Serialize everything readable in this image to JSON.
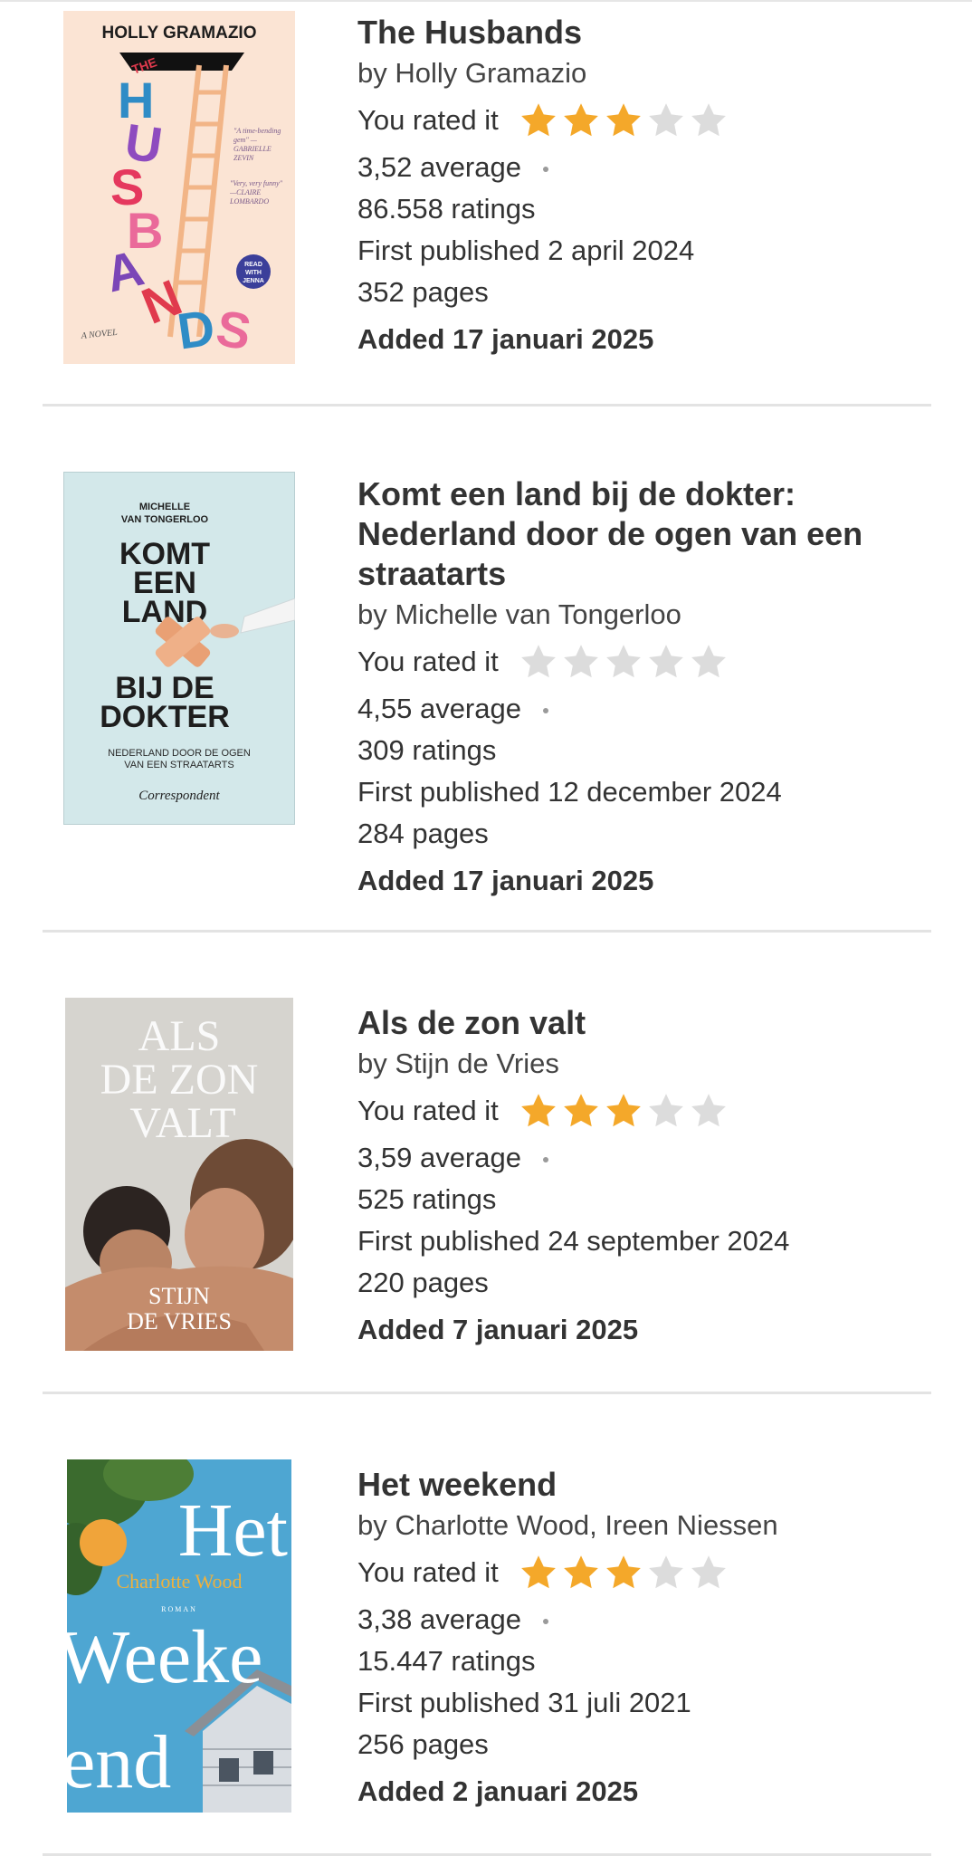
{
  "colors": {
    "star_filled": "#F4A82A",
    "star_empty": "#DCDCDC",
    "divider": "#E3E3E3",
    "text": "#333333"
  },
  "books": [
    {
      "title": "The Husbands",
      "author": "by Holly Gramazio",
      "rated_label": "You rated it",
      "user_rating": 3,
      "average": "3,52 average",
      "ratings": "86.558 ratings",
      "first_published": "First published 2 april 2024",
      "pages": "352 pages",
      "added": "Added 17 januari 2025",
      "cover": {
        "author_text": "HOLLY GRAMAZIO",
        "title_letters": [
          "H",
          "U",
          "S",
          "B",
          "A",
          "N",
          "D",
          "S"
        ],
        "the": "THE",
        "quote1": "\"A time-bending gem\" —GABRIELLE ZEVIN",
        "quote2": "\"Very, very funny\" —CLAIRE LOMBARDO",
        "badge": "READ WITH JENNA",
        "novel": "A NOVEL"
      }
    },
    {
      "title": "Komt een land bij de dokter: Nederland door de ogen van een straatarts",
      "author": "by Michelle van Tongerloo",
      "rated_label": "You rated it",
      "user_rating": 0,
      "average": "4,55 average",
      "ratings": "309 ratings",
      "first_published": "First published 12 december 2024",
      "pages": "284 pages",
      "added": "Added 17 januari 2025",
      "cover": {
        "author_line1": "MICHELLE",
        "author_line2": "VAN TONGERLOO",
        "t1": "KOMT",
        "t2": "EEN",
        "t3": "LAND",
        "t4": "BIJ DE",
        "t5": "DOKTER",
        "sub1": "NEDERLAND DOOR DE OGEN",
        "sub2": "VAN EEN STRAATARTS",
        "publisher": "Correspondent"
      }
    },
    {
      "title": "Als de zon valt",
      "author": "by Stijn de Vries",
      "rated_label": "You rated it",
      "user_rating": 3,
      "average": "3,59 average",
      "ratings": "525 ratings",
      "first_published": "First published 24 september 2024",
      "pages": "220 pages",
      "added": "Added 7 januari 2025",
      "cover": {
        "t1": "ALS",
        "t2": "DE ZON",
        "t3": "VALT",
        "a1": "STIJN",
        "a2": "DE VRIES"
      }
    },
    {
      "title": "Het weekend",
      "author": "by Charlotte Wood, Ireen Niessen",
      "rated_label": "You rated it",
      "user_rating": 3,
      "average": "3,38 average",
      "ratings": "15.447 ratings",
      "first_published": "First published 31 juli 2021",
      "pages": "256 pages",
      "added": "Added 2 januari 2025",
      "cover": {
        "t1": "Het",
        "author": "Charlotte Wood",
        "t2": "Weeke",
        "t3": "end",
        "genre": "ROMAN"
      }
    }
  ]
}
